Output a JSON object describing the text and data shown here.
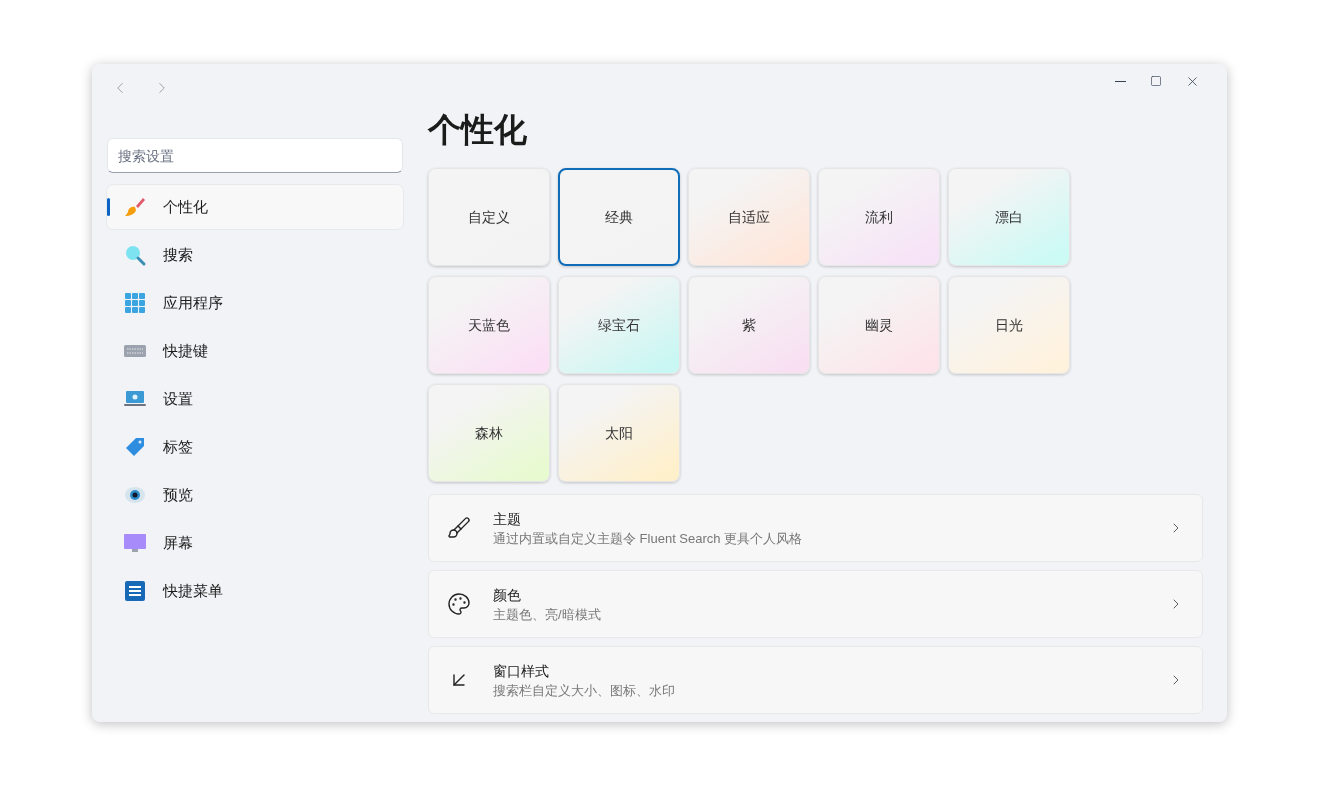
{
  "search": {
    "placeholder": "搜索设置"
  },
  "sidebar": {
    "items": [
      {
        "label": "个性化",
        "selected": true
      },
      {
        "label": "搜索",
        "selected": false
      },
      {
        "label": "应用程序",
        "selected": false
      },
      {
        "label": "快捷键",
        "selected": false
      },
      {
        "label": "设置",
        "selected": false
      },
      {
        "label": "标签",
        "selected": false
      },
      {
        "label": "预览",
        "selected": false
      },
      {
        "label": "屏幕",
        "selected": false
      },
      {
        "label": "快捷菜单",
        "selected": false
      }
    ]
  },
  "page_title": "个性化",
  "themes": [
    {
      "label": "自定义",
      "selected": false,
      "color": "#f3f3f3"
    },
    {
      "label": "经典",
      "selected": true,
      "color": "#f3f3f3"
    },
    {
      "label": "自适应",
      "selected": false,
      "color": "#ffe6d9"
    },
    {
      "label": "流利",
      "selected": false,
      "color": "#f7e3f7"
    },
    {
      "label": "漂白",
      "selected": false,
      "color": "#ccfaf5"
    },
    {
      "label": "天蓝色",
      "selected": false,
      "color": "#fbe0f5"
    },
    {
      "label": "绿宝石",
      "selected": false,
      "color": "#c9f7f3"
    },
    {
      "label": "紫",
      "selected": false,
      "color": "#f8e0f2"
    },
    {
      "label": "幽灵",
      "selected": false,
      "color": "#fde4ea"
    },
    {
      "label": "日光",
      "selected": false,
      "color": "#fff2dd"
    },
    {
      "label": "森林",
      "selected": false,
      "color": "#e8fad0"
    },
    {
      "label": "太阳",
      "selected": false,
      "color": "#fff0cc"
    }
  ],
  "settings": [
    {
      "title": "主题",
      "description": "通过内置或自定义主题令 Fluent Search 更具个人风格"
    },
    {
      "title": "颜色",
      "description": "主题色、亮/暗模式"
    },
    {
      "title": "窗口样式",
      "description": "搜索栏自定义大小、图标、水印"
    }
  ]
}
